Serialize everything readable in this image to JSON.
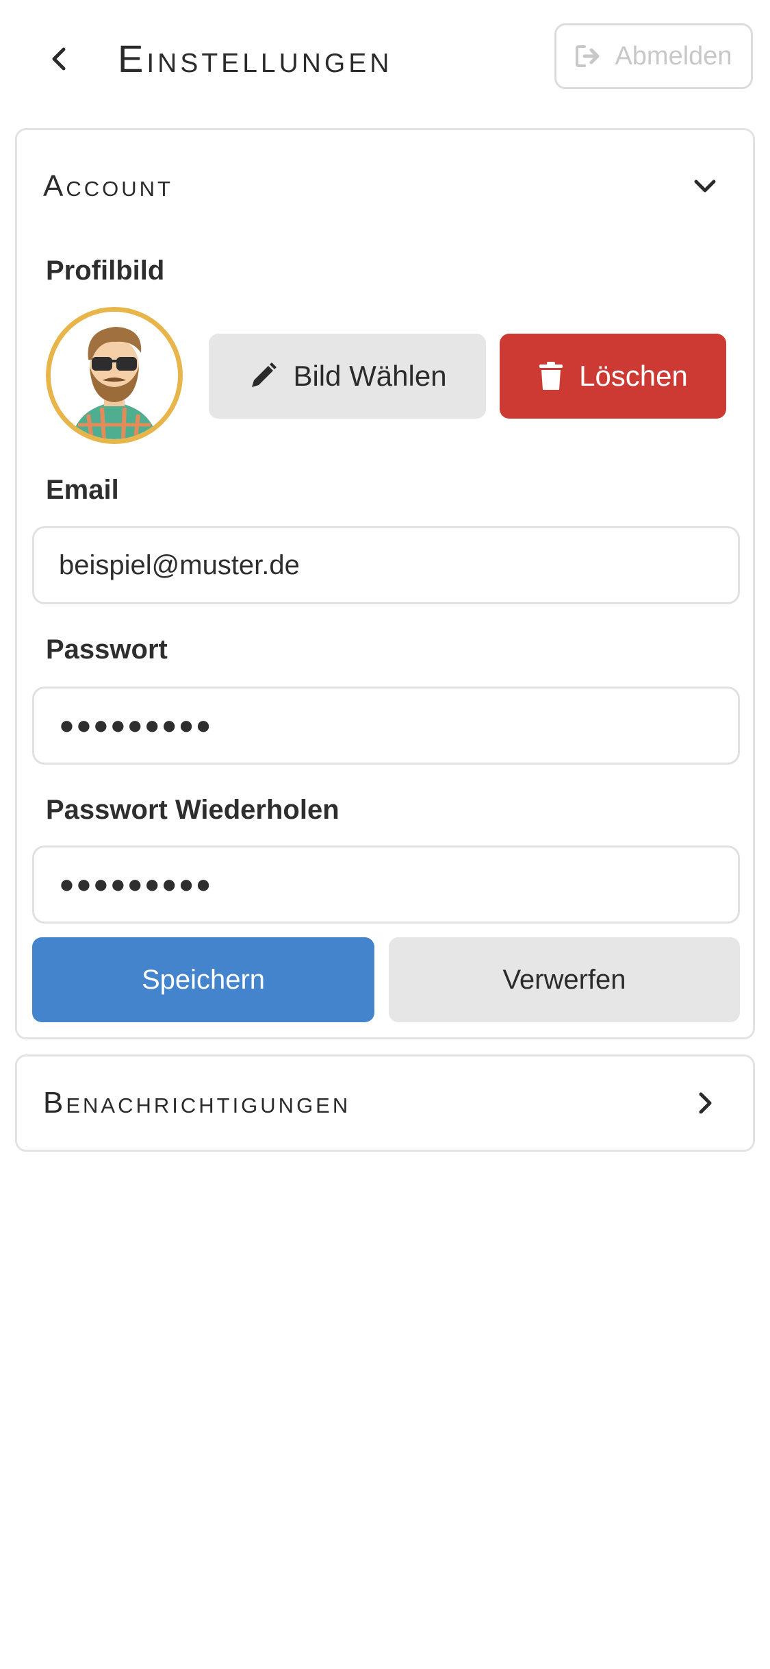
{
  "header": {
    "title": "Einstellungen",
    "logout_label": "Abmelden"
  },
  "account": {
    "title": "Account",
    "profile_label": "Profilbild",
    "choose_image_label": "Bild Wählen",
    "delete_label": "Löschen",
    "email_label": "Email",
    "email_value": "beispiel@muster.de",
    "password_label": "Passwort",
    "password_value": "●●●●●●●●●",
    "password_repeat_label": "Passwort Wiederholen",
    "password_repeat_value": "●●●●●●●●●",
    "save_label": "Speichern",
    "discard_label": "Verwerfen"
  },
  "notifications": {
    "title": "Benachrichtigungen"
  },
  "icons": {
    "back": "chevron-left-icon",
    "logout": "sign-out-icon",
    "account_toggle": "chevron-down-icon",
    "choose": "pencil-icon",
    "delete": "trash-icon",
    "notifications_toggle": "chevron-right-icon"
  },
  "colors": {
    "accent_blue": "#4384cc",
    "danger_red": "#cc3a33",
    "avatar_ring": "#e8b54a",
    "neutral_button": "#e6e6e6"
  }
}
